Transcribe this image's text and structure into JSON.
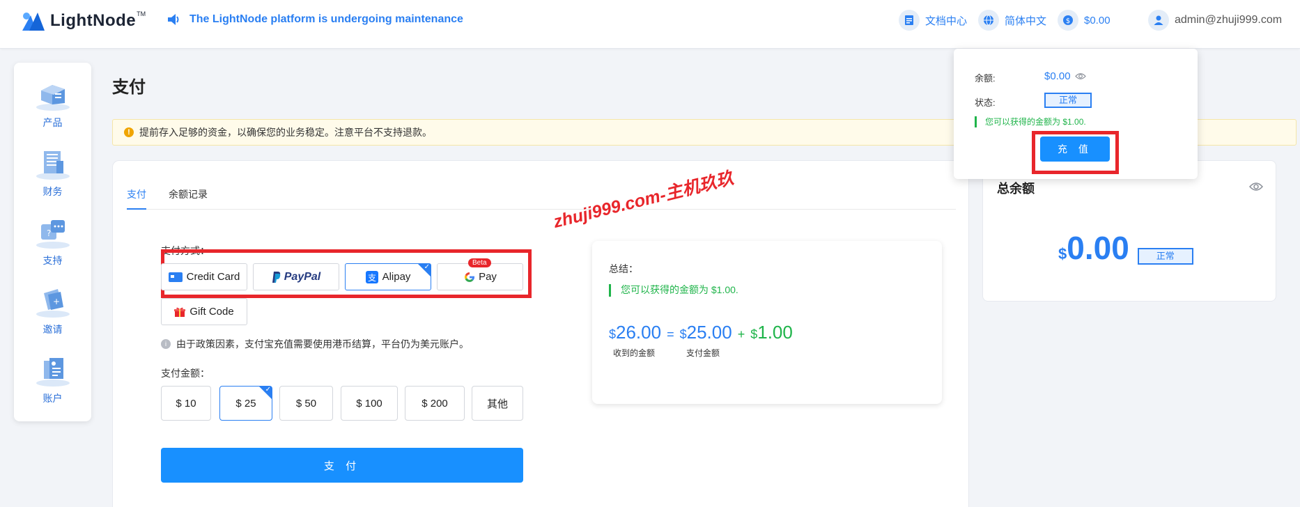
{
  "header": {
    "logo_text": "LightNode",
    "logo_tm": "TM",
    "notice": "The LightNode platform is undergoing maintenance",
    "docs": "文档中心",
    "language": "简体中文",
    "balance": "$0.00",
    "user": "admin@zhuji999.com"
  },
  "sidebar": {
    "items": [
      {
        "label": "产品",
        "icon": "products-icon"
      },
      {
        "label": "财务",
        "icon": "finance-icon"
      },
      {
        "label": "支持",
        "icon": "support-icon"
      },
      {
        "label": "邀请",
        "icon": "invite-icon"
      },
      {
        "label": "账户",
        "icon": "account-icon"
      }
    ]
  },
  "page": {
    "title": "支付",
    "alert": "提前存入足够的资金，以确保您的业务稳定。注意平台不支持退款。"
  },
  "tabs": [
    {
      "label": "支付",
      "active": true
    },
    {
      "label": "余额记录",
      "active": false
    }
  ],
  "payment": {
    "method_label": "支付方式：",
    "methods": [
      {
        "label": "Credit Card",
        "selected": false
      },
      {
        "label": "PayPal",
        "selected": false
      },
      {
        "label": "Alipay",
        "selected": true
      },
      {
        "label": "Pay",
        "badge": "Beta",
        "selected": false
      },
      {
        "label": "Gift Code",
        "selected": false
      }
    ],
    "policy_note": "由于政策因素，支付宝充值需要使用港币结算，平台仍为美元账户。",
    "amount_label": "支付金额：",
    "amounts": [
      {
        "label": "$ 10",
        "selected": false
      },
      {
        "label": "$ 25",
        "selected": true
      },
      {
        "label": "$ 50",
        "selected": false
      },
      {
        "label": "$ 100",
        "selected": false
      },
      {
        "label": "$ 200",
        "selected": false
      },
      {
        "label": "其他",
        "selected": false
      }
    ],
    "pay_button": "支 付"
  },
  "summary": {
    "title": "总结：",
    "bonus_note": "您可以获得的金额为 $1.00.",
    "currency": "$",
    "received": "26.00",
    "equals": "=",
    "paid": "25.00",
    "plus": "+",
    "bonus": "1.00",
    "received_label": "收到的金额",
    "paid_label": "支付金额"
  },
  "balance_card": {
    "title": "总余额",
    "currency": "$",
    "amount": "0.00",
    "status": "正常"
  },
  "popover": {
    "balance_label": "余额:",
    "balance_value": "$0.00",
    "status_label": "状态:",
    "status_value": "正常",
    "bonus_note": "您可以获得的金额为 $1.00.",
    "recharge_button": "充 值"
  },
  "watermark": "zhuji999.com-主机玖玖",
  "colors": {
    "accent": "#2a7ff2",
    "button": "#1890ff",
    "green": "#1fb44a",
    "highlight_frame": "#e8262b",
    "alert_bg": "#fffbea"
  }
}
